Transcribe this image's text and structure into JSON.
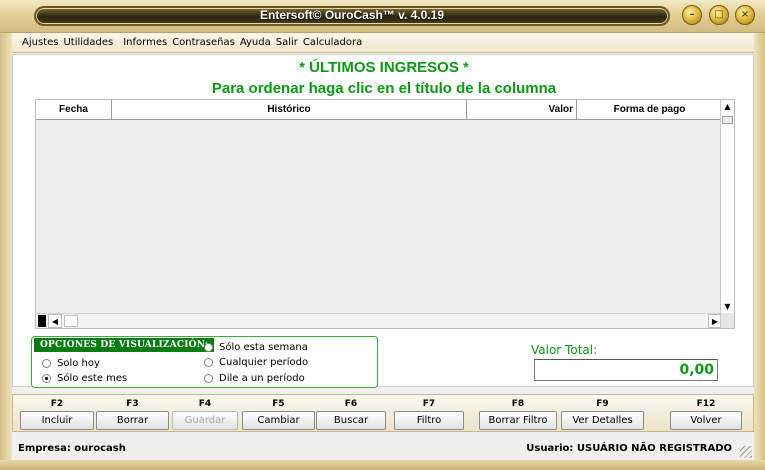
{
  "window": {
    "title": "Entersoft© OuroCash™ v. 4.0.19",
    "buttons": [
      "minimize-icon",
      "restore-icon",
      "close-icon"
    ]
  },
  "menu": {
    "items": [
      "Ajustes",
      "Utilidades",
      "Informes",
      "Contraseñas",
      "Ayuda",
      "Salir",
      "Calculadora"
    ]
  },
  "main": {
    "heading": "* ÚLTIMOS INGRESOS *",
    "subheading": "Para ordenar haga clic en el título de la columna",
    "columns": [
      "Fecha",
      "Histórico",
      "Valor",
      "Forma de pago"
    ],
    "rows": []
  },
  "options": {
    "label": "OPCIONES DE VISUALIZACIÓN:",
    "radios": [
      {
        "label": "Solo hoy",
        "checked": false
      },
      {
        "label": "Sólo este mes",
        "checked": true
      },
      {
        "label": "Sólo esta semana",
        "checked": false
      },
      {
        "label": "Cualquier período",
        "checked": false
      },
      {
        "label": "Dile a un período",
        "checked": false
      }
    ]
  },
  "total": {
    "label": "Valor Total:",
    "value": "0,00"
  },
  "fkeys": [
    {
      "key": "F2",
      "label": "Incluir",
      "enabled": true
    },
    {
      "key": "F3",
      "label": "Borrar",
      "enabled": true
    },
    {
      "key": "F4",
      "label": "Guardar",
      "enabled": false
    },
    {
      "key": "F5",
      "label": "Cambiar",
      "enabled": true
    },
    {
      "key": "F6",
      "label": "Buscar",
      "enabled": true
    },
    {
      "key": "F7",
      "label": "Filtro",
      "enabled": true
    },
    {
      "key": "F8",
      "label": "Borrar Filtro",
      "enabled": true
    },
    {
      "key": "F9",
      "label": "Ver Detalles",
      "enabled": true
    },
    {
      "key": "F12",
      "label": "Volver",
      "enabled": true
    }
  ],
  "status": {
    "company": "Empresa: ourocash",
    "user": "Usuario: USUÁRIO NÃO REGISTRADO"
  },
  "colors": {
    "accent_green": "#0c9a14",
    "options_label_bg": "#0b7b13",
    "frame_gold": "#d2bd80"
  }
}
